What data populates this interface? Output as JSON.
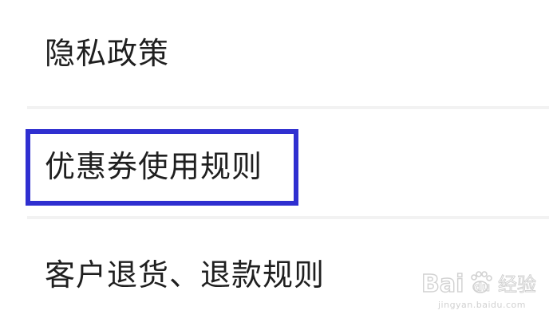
{
  "menu": {
    "items": [
      {
        "label": "隐私政策"
      },
      {
        "label": "优惠券使用规则"
      },
      {
        "label": "客户退货、退款规则"
      }
    ]
  },
  "watermark": {
    "brand": "Bai du 经验",
    "url": "jingyan.baidu.com"
  },
  "colors": {
    "highlight_border": "#2f2fd0",
    "text": "#1f1f1f",
    "divider": "#f2f2f2"
  }
}
